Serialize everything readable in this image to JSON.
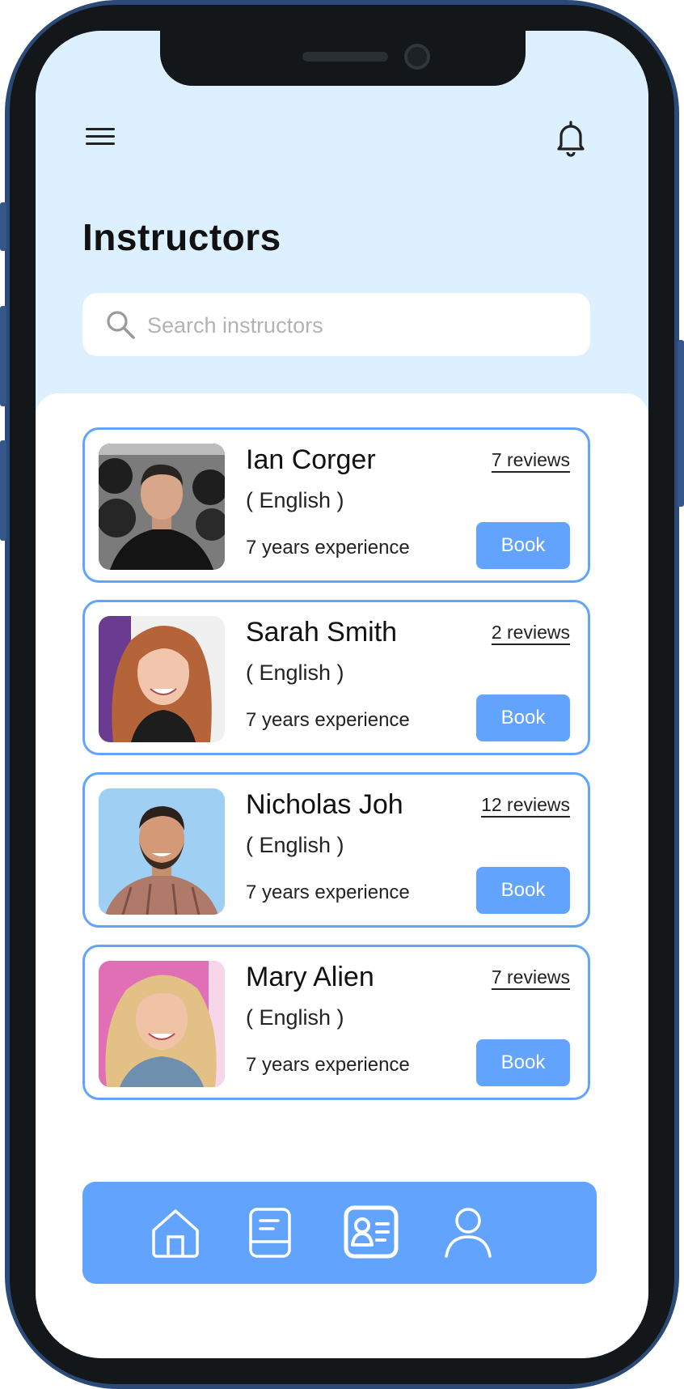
{
  "header": {
    "title": "Instructors"
  },
  "search": {
    "placeholder": "Search instructors",
    "value": ""
  },
  "instructors": [
    {
      "name": "Ian Corger",
      "language": "( English )",
      "experience": "7 years experience",
      "reviews": "7 reviews",
      "book_label": "Book"
    },
    {
      "name": "Sarah Smith",
      "language": "( English )",
      "experience": "7 years experience",
      "reviews": "2 reviews",
      "book_label": "Book"
    },
    {
      "name": "Nicholas Joh",
      "language": "( English )",
      "experience": "7 years experience",
      "reviews": "12 reviews",
      "book_label": "Book"
    },
    {
      "name": "Mary Alien",
      "language": "( English )",
      "experience": "7 years experience",
      "reviews": "7 reviews",
      "book_label": "Book"
    }
  ],
  "bottom_nav": {
    "items": [
      {
        "icon": "home-icon",
        "active": false
      },
      {
        "icon": "book-icon",
        "active": false
      },
      {
        "icon": "id-card-icon",
        "active": true
      },
      {
        "icon": "user-icon",
        "active": false
      }
    ]
  },
  "colors": {
    "accent": "#62a4fd",
    "header_bg": "#dcf0ff",
    "frame": "#13171a",
    "frame_edge": "#2c4a78"
  }
}
